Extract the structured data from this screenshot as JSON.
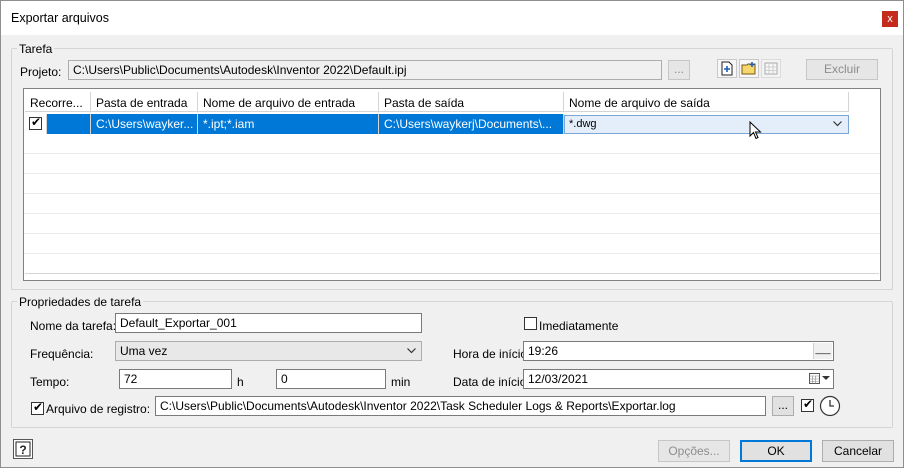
{
  "window": {
    "title": "Exportar arquivos",
    "close_label": "x"
  },
  "tarefa": {
    "legend": "Tarefa",
    "projeto_label": "Projeto:",
    "projeto_value": "C:\\Users\\Public\\Documents\\Autodesk\\Inventor 2022\\Default.ipj",
    "browse_label": "...",
    "excluir_label": "Excluir"
  },
  "grid": {
    "columns": [
      "Recorre...",
      "Pasta de entrada",
      "Nome de arquivo de entrada",
      "Pasta de saída",
      "Nome de arquivo de saída"
    ],
    "rows": [
      {
        "checked": true,
        "pasta_entrada": "C:\\Users\\wayker...",
        "nome_entrada": "*.ipt;*.iam",
        "pasta_saida": "C:\\Users\\waykerj\\Documents\\...",
        "nome_saida": "*.dwg"
      }
    ]
  },
  "propriedades": {
    "legend": "Propriedades de tarefa",
    "nome_label": "Nome da tarefa:",
    "nome_value": "Default_Exportar_001",
    "imediatamente_label": "Imediatamente",
    "imediatamente_checked": false,
    "frequencia_label": "Frequência:",
    "frequencia_value": "Uma vez",
    "hora_label": "Hora de início:",
    "hora_value": "19:26",
    "tempo_label": "Tempo:",
    "tempo_h_value": "72",
    "h_label": "h",
    "tempo_min_value": "0",
    "min_label": "min",
    "data_label": "Data de início:",
    "data_value": "12/03/2021",
    "registro_label": "Arquivo de registro:",
    "registro_checked": true,
    "registro_value": "C:\\Users\\Public\\Documents\\Autodesk\\Inventor 2022\\Task Scheduler Logs & Reports\\Exportar.log",
    "registro_browse": "...",
    "registro_option_checked": true
  },
  "footer": {
    "help_icon": "question-icon",
    "opcoes_label": "Opções...",
    "ok_label": "OK",
    "cancelar_label": "Cancelar"
  },
  "colors": {
    "selection": "#0078d7",
    "close": "#c42b1c"
  }
}
